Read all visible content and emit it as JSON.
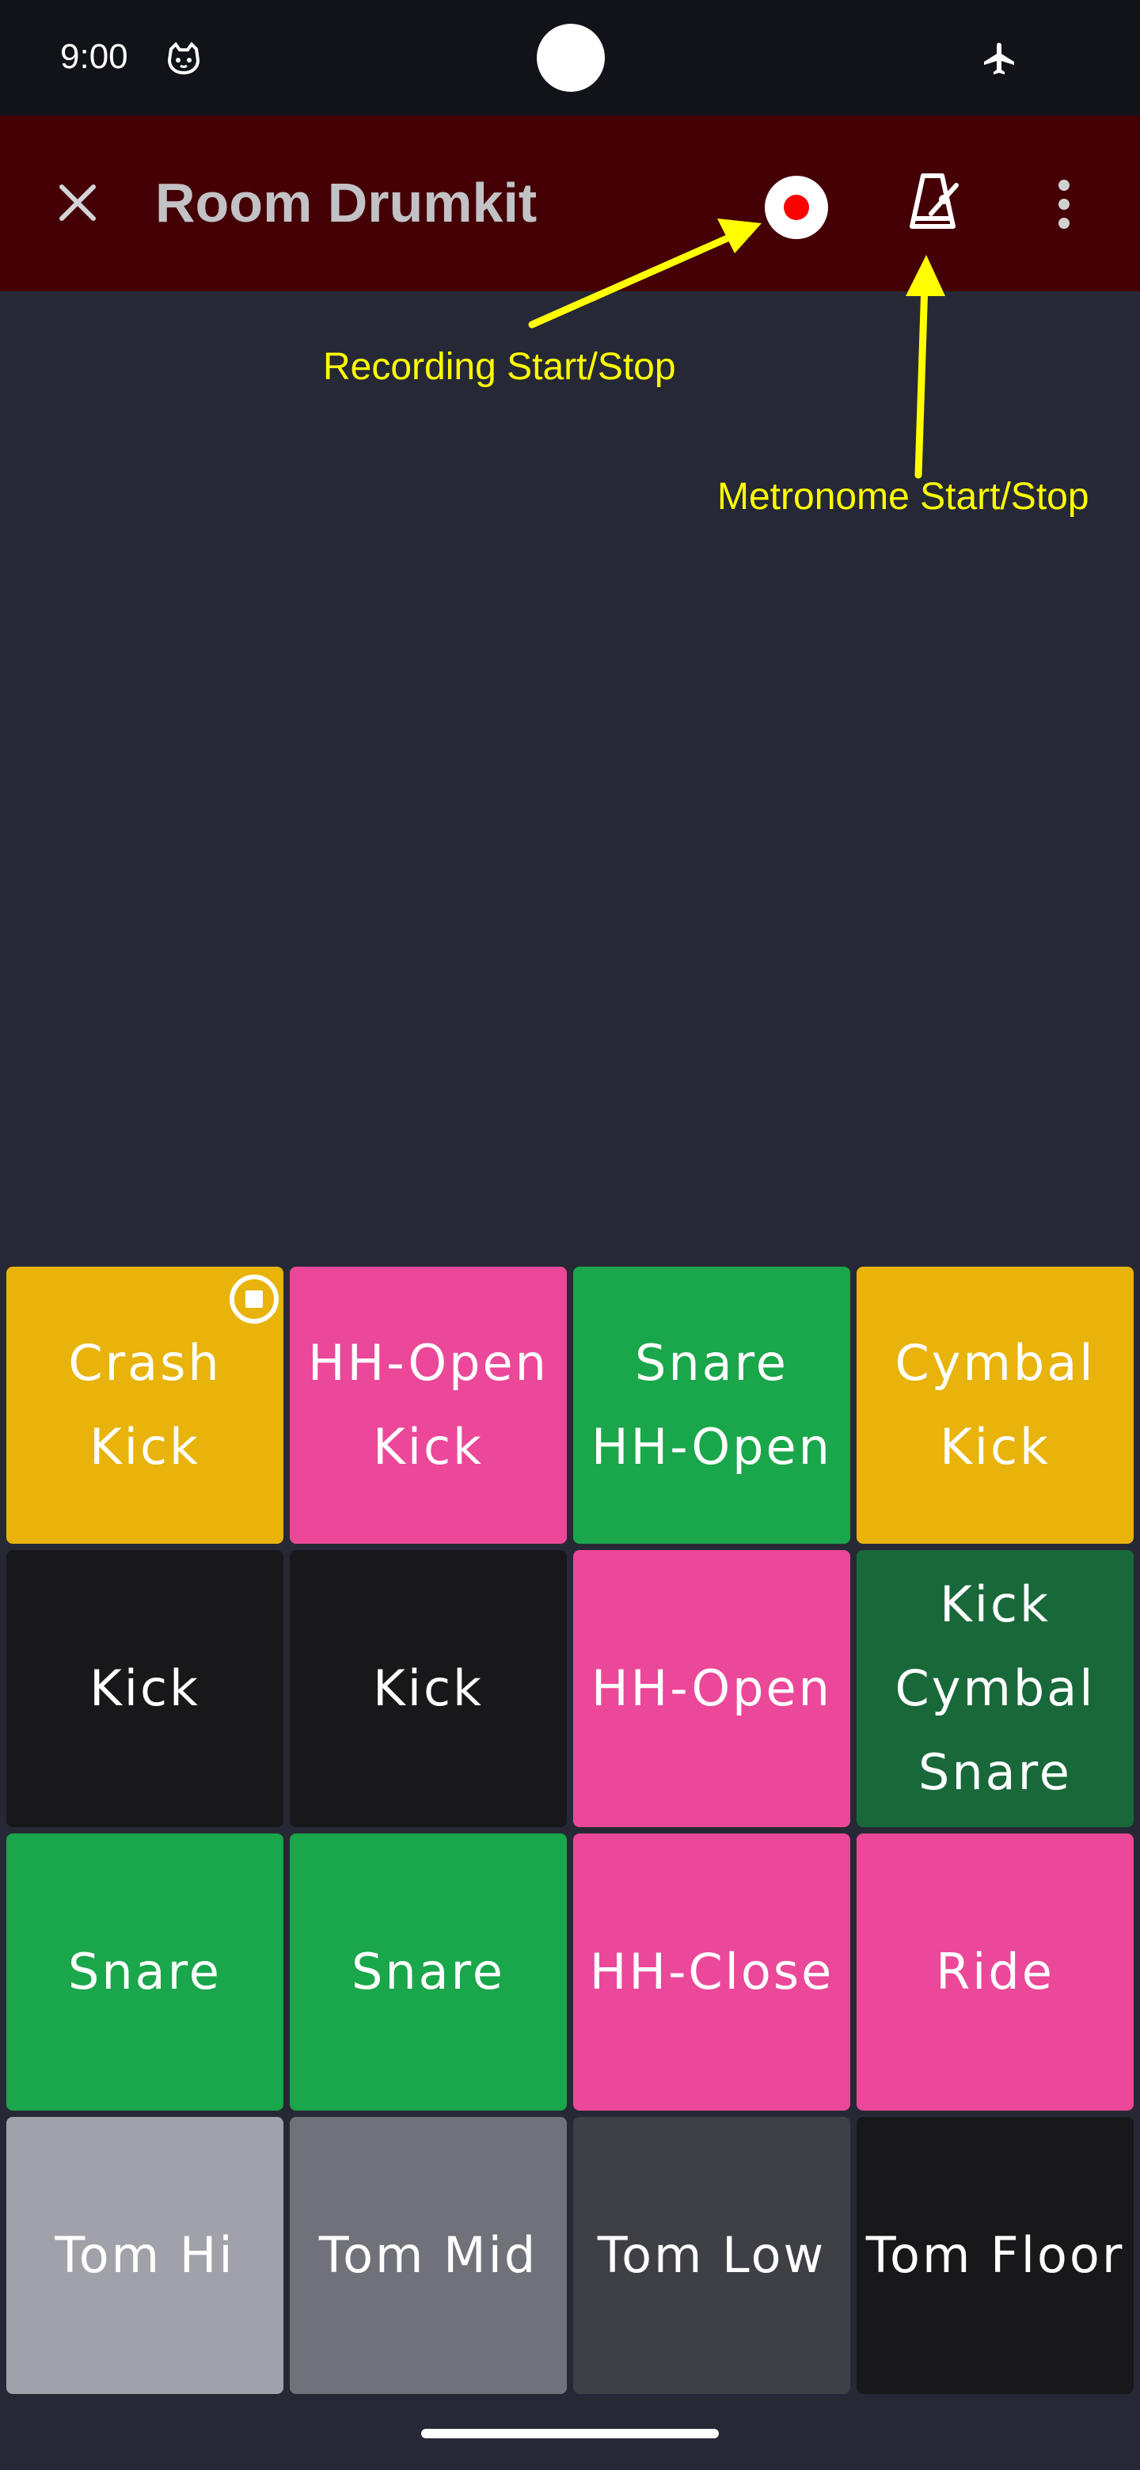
{
  "status_bar": {
    "time": "9:00",
    "icons": [
      "cat-face-icon",
      "airplane-mode-icon"
    ]
  },
  "app_bar": {
    "title": "Room Drumkit",
    "background": "#440005",
    "icons": [
      "close-icon",
      "record-icon",
      "metronome-icon",
      "more-vert-icon"
    ]
  },
  "annotations": {
    "recording": "Recording Start/Stop",
    "metronome": "Metronome Start/Stop",
    "color": "#ffff00"
  },
  "colors": {
    "yellow": "#e8b30b",
    "pink": "#eb4899",
    "green": "#1aa64a",
    "dark_green": "#19683a",
    "black": "#18181b",
    "gray_light": "#a1a1aa",
    "gray_mid": "#71717a",
    "gray_dark": "#3f3f46"
  },
  "pads": [
    {
      "lines": [
        "Crash",
        "Kick"
      ],
      "color": "#e8b30b",
      "stop_icon": true
    },
    {
      "lines": [
        "HH-Open",
        "Kick"
      ],
      "color": "#eb4899"
    },
    {
      "lines": [
        "Snare",
        "HH-Open"
      ],
      "color": "#1aa64a"
    },
    {
      "lines": [
        "Cymbal",
        "Kick"
      ],
      "color": "#e8b30b"
    },
    {
      "lines": [
        "Kick"
      ],
      "color": "#18181b"
    },
    {
      "lines": [
        "Kick"
      ],
      "color": "#18181b"
    },
    {
      "lines": [
        "HH-Open"
      ],
      "color": "#eb4899"
    },
    {
      "lines": [
        "Kick",
        "Cymbal",
        "Snare"
      ],
      "color": "#19683a"
    },
    {
      "lines": [
        "Snare"
      ],
      "color": "#1aa64a"
    },
    {
      "lines": [
        "Snare"
      ],
      "color": "#1aa64a"
    },
    {
      "lines": [
        "HH-Close"
      ],
      "color": "#eb4899"
    },
    {
      "lines": [
        "Ride"
      ],
      "color": "#eb4899"
    },
    {
      "lines": [
        "Tom Hi"
      ],
      "color": "#a1a1aa"
    },
    {
      "lines": [
        "Tom Mid"
      ],
      "color": "#71717a"
    },
    {
      "lines": [
        "Tom Low"
      ],
      "color": "#3f3f46"
    },
    {
      "lines": [
        "Tom Floor"
      ],
      "color": "#18181b"
    }
  ]
}
